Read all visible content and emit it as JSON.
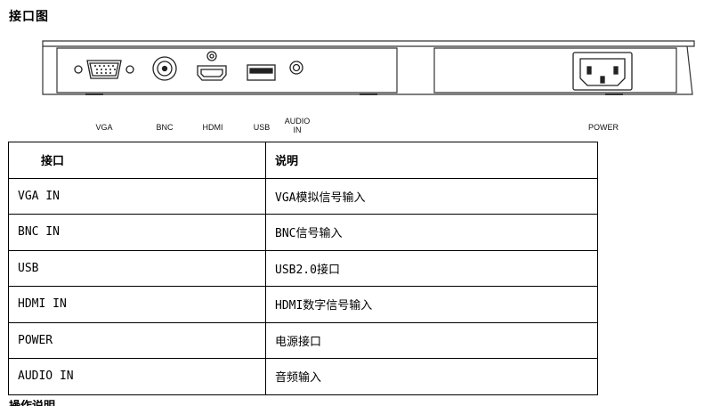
{
  "page": {
    "title": "接口图"
  },
  "diagram": {
    "port_labels": {
      "vga": "VGA",
      "bnc": "BNC",
      "hdmi": "HDMI",
      "usb": "USB",
      "audio": "AUDIO\nIN",
      "power": "POWER"
    }
  },
  "table": {
    "headers": [
      "接口",
      "说明"
    ],
    "rows": [
      [
        "VGA IN",
        "VGA模拟信号输入"
      ],
      [
        "BNC IN",
        "BNC信号输入"
      ],
      [
        "USB",
        "USB2.0接口"
      ],
      [
        "HDMI IN",
        "HDMI数字信号输入"
      ],
      [
        "POWER",
        "电源接口"
      ],
      [
        "AUDIO IN",
        "音频输入"
      ]
    ]
  },
  "next_heading": "操作说明"
}
